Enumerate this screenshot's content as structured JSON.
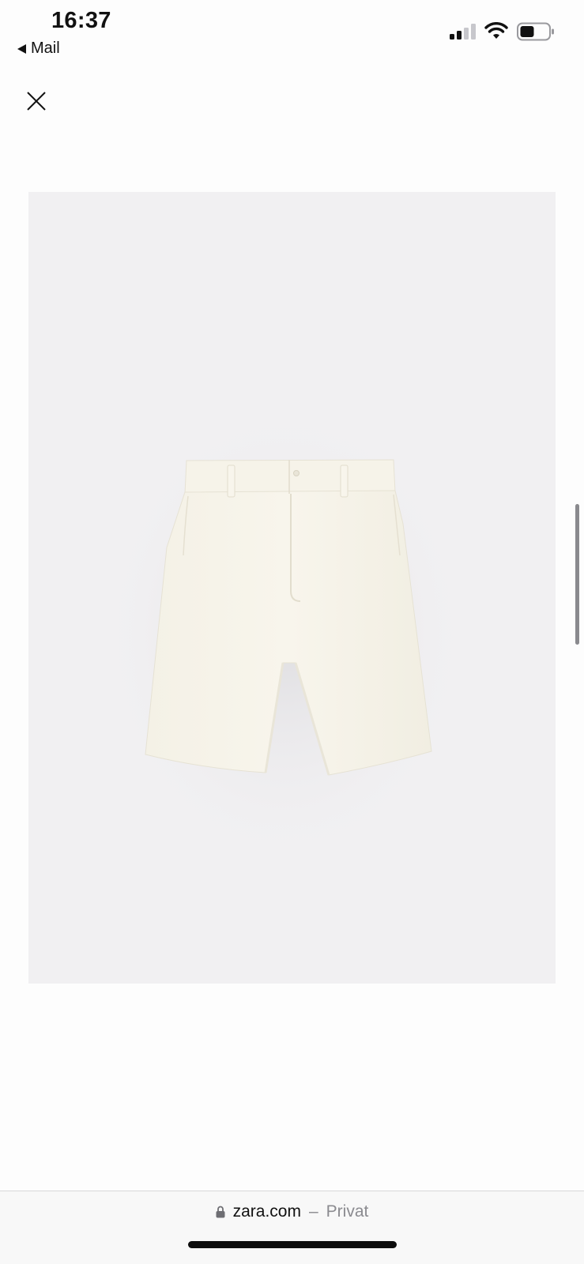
{
  "status": {
    "time": "16:37",
    "back_app": "Mail"
  },
  "address": {
    "domain": "zara.com",
    "separator": "–",
    "mode": "Privat"
  },
  "product": {
    "image_subject": "cream shorts"
  },
  "colors": {
    "image_background": "#f1f0f2",
    "garment": "#f7f4ea"
  },
  "icons": [
    "signal-icon",
    "wifi-icon",
    "battery-icon",
    "close-icon",
    "lock-icon"
  ]
}
